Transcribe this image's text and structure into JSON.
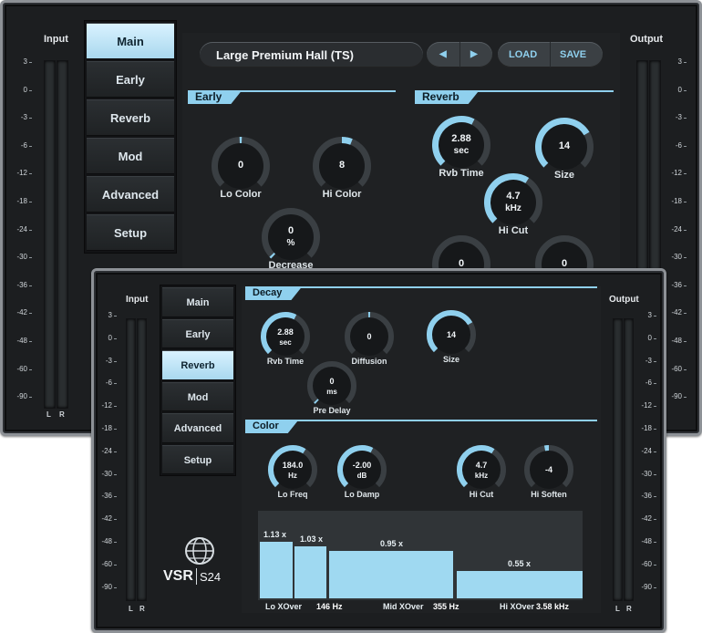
{
  "back_window": {
    "input_label": "Input",
    "output_label": "Output",
    "scale": [
      "3",
      "0",
      "-3",
      "-6",
      "-12",
      "-18",
      "-24",
      "-30",
      "-36",
      "-42",
      "-48",
      "-60",
      "-90"
    ],
    "lr": {
      "l": "L",
      "r": "R"
    },
    "nav": [
      "Main",
      "Early",
      "Reverb",
      "Mod",
      "Advanced",
      "Setup"
    ],
    "active_nav": "Main",
    "preset_name": "Large Premium Hall (TS)",
    "prev_glyph": "◀",
    "next_glyph": "▶",
    "load_label": "LOAD",
    "save_label": "SAVE",
    "early_title": "Early",
    "reverb_title": "Reverb",
    "knobs": [
      {
        "id": "lo-color",
        "value": "0",
        "unit": "",
        "label": "Lo Color",
        "level": 0.5,
        "mode": "center"
      },
      {
        "id": "hi-color",
        "value": "8",
        "unit": "",
        "label": "Hi Color",
        "level": 0.58,
        "mode": "center"
      },
      {
        "id": "decrease",
        "value": "0",
        "unit": "%",
        "label": "Decrease",
        "level": 0.0,
        "mode": "left"
      },
      {
        "id": "rvb-time",
        "value": "2.88",
        "unit": "sec",
        "label": "Rvb Time",
        "level": 0.6,
        "mode": "left"
      },
      {
        "id": "size",
        "value": "14",
        "unit": "",
        "label": "Size",
        "level": 0.72,
        "mode": "left"
      },
      {
        "id": "hi-cut",
        "value": "4.7",
        "unit": "kHz",
        "label": "Hi Cut",
        "level": 0.62,
        "mode": "left"
      },
      {
        "id": "extra-1",
        "value": "0",
        "unit": "",
        "label": "",
        "level": 0.0,
        "mode": "left"
      },
      {
        "id": "extra-2",
        "value": "0",
        "unit": "",
        "label": "",
        "level": 0.0,
        "mode": "left"
      }
    ]
  },
  "front_window": {
    "input_label": "Input",
    "output_label": "Output",
    "scale": [
      "3",
      "0",
      "-3",
      "-6",
      "-12",
      "-18",
      "-24",
      "-30",
      "-36",
      "-42",
      "-48",
      "-60",
      "-90"
    ],
    "lr": {
      "l": "L",
      "r": "R"
    },
    "nav": [
      "Main",
      "Early",
      "Reverb",
      "Mod",
      "Advanced",
      "Setup"
    ],
    "active_nav": "Reverb",
    "logo_text": "VSR",
    "logo_model": "S24",
    "decay_title": "Decay",
    "color_title": "Color",
    "knobs": [
      {
        "id": "rvb-time",
        "value": "2.88",
        "unit": "sec",
        "label": "Rvb Time",
        "level": 0.6,
        "mode": "left"
      },
      {
        "id": "diffusion",
        "value": "0",
        "unit": "",
        "label": "Diffusion",
        "level": 0.5,
        "mode": "center"
      },
      {
        "id": "size",
        "value": "14",
        "unit": "",
        "label": "Size",
        "level": 0.72,
        "mode": "left"
      },
      {
        "id": "pre-delay",
        "value": "0",
        "unit": "ms",
        "label": "Pre Delay",
        "level": 0.0,
        "mode": "left"
      },
      {
        "id": "lo-freq",
        "value": "184.0",
        "unit": "Hz",
        "label": "Lo Freq",
        "level": 0.62,
        "mode": "left"
      },
      {
        "id": "lo-damp",
        "value": "-2.00",
        "unit": "dB",
        "label": "Lo Damp",
        "level": 0.6,
        "mode": "left"
      },
      {
        "id": "hi-cut",
        "value": "4.7",
        "unit": "kHz",
        "label": "Hi Cut",
        "level": 0.62,
        "mode": "left"
      },
      {
        "id": "hi-soften",
        "value": "-4",
        "unit": "",
        "label": "Hi Soften",
        "level": 0.46,
        "mode": "center"
      }
    ],
    "bands": [
      {
        "label": "1.13 x",
        "level": 1.13
      },
      {
        "label": "1.03 x",
        "level": 1.03
      },
      {
        "label": "0.95 x",
        "level": 0.95
      },
      {
        "label": "0.55 x",
        "level": 0.55
      }
    ],
    "xovers": [
      {
        "label": "Lo XOver",
        "value": "146 Hz"
      },
      {
        "label": "Mid XOver",
        "value": "355 Hz"
      },
      {
        "label": "Hi XOver",
        "value": "3.58 kHz"
      }
    ],
    "colors": {
      "accent": "#8fd0ee",
      "bar": "#9fd9f1",
      "panel": "#1f2123"
    }
  }
}
